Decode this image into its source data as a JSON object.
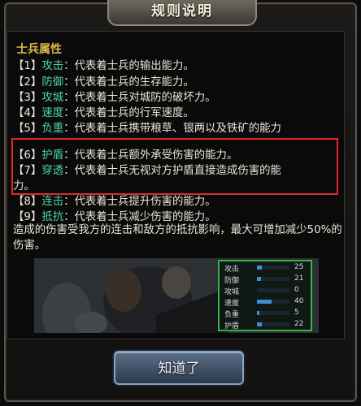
{
  "dialog": {
    "title": "规则说明"
  },
  "section": {
    "title": "士兵属性"
  },
  "rules": [
    {
      "idx": "【1】",
      "key": "攻击",
      "text": "：代表着士兵的输出能力。"
    },
    {
      "idx": "【2】",
      "key": "防御",
      "text": "：代表着士兵的生存能力。"
    },
    {
      "idx": "【3】",
      "key": "攻城",
      "text": "：代表着士兵对城防的破坏力。"
    },
    {
      "idx": "【4】",
      "key": "速度",
      "text": "：代表着士兵的行军速度。"
    },
    {
      "idx": "【5】",
      "key": "负重",
      "text": "：代表着士兵携带粮草、银两以及铁矿的能力"
    },
    {
      "idx": "【6】",
      "key": "护盾",
      "text": "：代表着士兵额外承受伤害的能力。"
    },
    {
      "idx": "【7】",
      "key": "穿透",
      "text": "：代表着士兵无视对方护盾直接造成伤害的能"
    },
    {
      "idx": "【8】",
      "key": "连击",
      "text": "：代表着士兵提升伤害的能力。"
    },
    {
      "idx": "【9】",
      "key": "抵抗",
      "text": "：代表着士兵减少伤害的能力。"
    }
  ],
  "rule7_continuation": "力。",
  "summary": "造成的伤害受我方的连击和敌方的抵抗影响，最大可增加减少50%的伤害。",
  "stats": [
    {
      "label": "攻击",
      "value": "25",
      "level": 0.15
    },
    {
      "label": "防御",
      "value": "21",
      "level": 0.12
    },
    {
      "label": "攻城",
      "value": "0",
      "level": 0.0
    },
    {
      "label": "速度",
      "value": "40",
      "level": 0.45
    },
    {
      "label": "负重",
      "value": "5",
      "level": 0.08
    },
    {
      "label": "护盾",
      "value": "22",
      "level": 0.15
    }
  ],
  "button": {
    "ok_label": "知道了"
  },
  "colors": {
    "key": "#4bd6a3",
    "highlight": "#e02a2a",
    "section": "#e0b84a"
  }
}
